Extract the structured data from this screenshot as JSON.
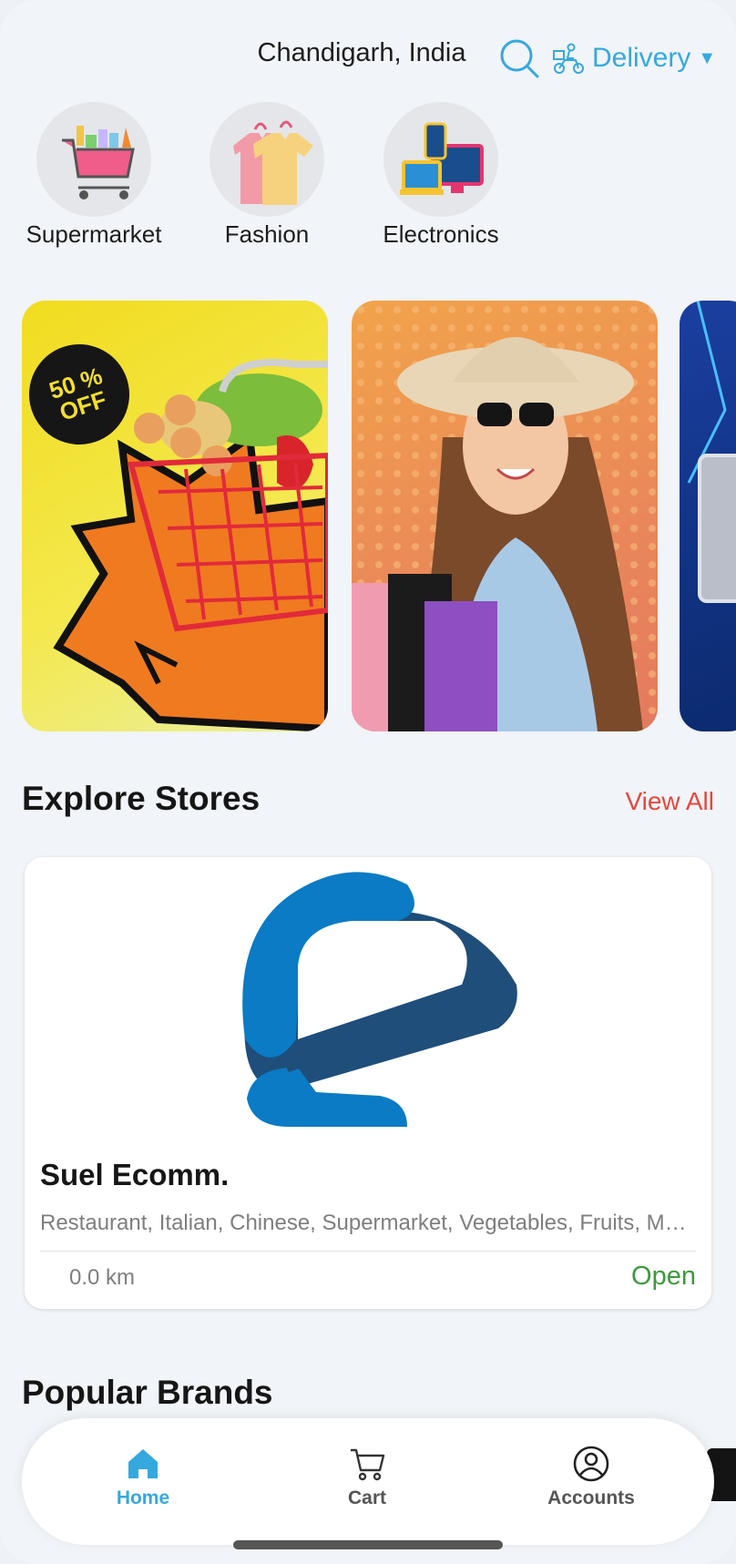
{
  "header": {
    "location": "Chandigarh, India",
    "search_icon": "search-icon",
    "delivery_label": "Delivery",
    "delivery_icon": "scooter-icon",
    "accent": "#35a8de"
  },
  "categories": [
    {
      "label": "Supermarket",
      "icon": "shopping-cart-icon"
    },
    {
      "label": "Fashion",
      "icon": "clothes-icon"
    },
    {
      "label": "Electronics",
      "icon": "devices-icon"
    }
  ],
  "banners": [
    {
      "badge_line1": "50 %",
      "badge_line2": "OFF"
    },
    {},
    {}
  ],
  "explore": {
    "title": "Explore Stores",
    "view_all": "View All",
    "store": {
      "name": "Suel Ecomm.",
      "tags": "Restaurant, Italian, Chinese, Supermarket, Vegetables, Fruits, Meat, Bakery",
      "distance": "0.0 km",
      "status": "Open",
      "status_color": "#3b9a3b"
    }
  },
  "popular": {
    "title": "Popular Brands"
  },
  "bottom_nav": [
    {
      "label": "Home",
      "icon": "home-icon",
      "active": true
    },
    {
      "label": "Cart",
      "icon": "cart-icon",
      "active": false
    },
    {
      "label": "Accounts",
      "icon": "account-icon",
      "active": false
    }
  ]
}
